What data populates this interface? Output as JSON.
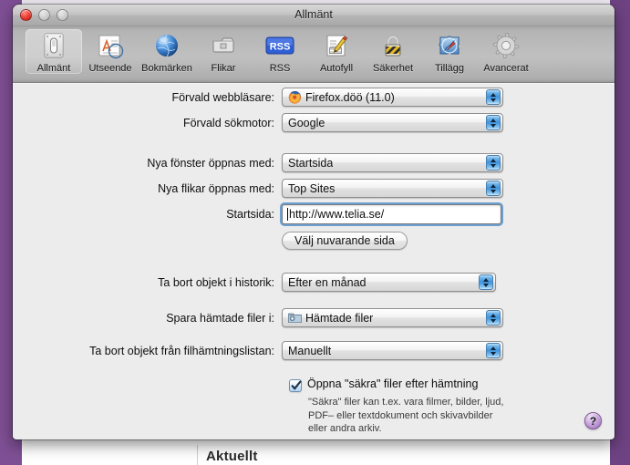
{
  "backdrop": {
    "heading": "Aktuellt",
    "purple": "#7e4f94"
  },
  "window": {
    "title": "Allmänt",
    "controls": {
      "close": "close-button",
      "minimize": "minimize-button",
      "zoom": "zoom-button"
    }
  },
  "toolbar": {
    "items": [
      {
        "label": "Allmänt",
        "icon": "general-switch-icon",
        "selected": true
      },
      {
        "label": "Utseende",
        "icon": "appearance-icon",
        "selected": false
      },
      {
        "label": "Bokmärken",
        "icon": "globe-bookmarks-icon",
        "selected": false
      },
      {
        "label": "Flikar",
        "icon": "tabs-icon",
        "selected": false
      },
      {
        "label": "RSS",
        "icon": "rss-icon",
        "selected": false
      },
      {
        "label": "Autofyll",
        "icon": "autofill-pencil-icon",
        "selected": false
      },
      {
        "label": "Säkerhet",
        "icon": "padlock-icon",
        "selected": false
      },
      {
        "label": "Tillägg",
        "icon": "extensions-puzzle-icon",
        "selected": false
      },
      {
        "label": "Avancerat",
        "icon": "gear-icon",
        "selected": false
      }
    ]
  },
  "form": {
    "default_browser": {
      "label": "Förvald webbläsare:",
      "value": "Firefox.döö (11.0)",
      "icon": "firefox-icon"
    },
    "default_search": {
      "label": "Förvald sökmotor:",
      "value": "Google"
    },
    "new_windows": {
      "label": "Nya fönster öppnas med:",
      "value": "Startsida"
    },
    "new_tabs": {
      "label": "Nya flikar öppnas med:",
      "value": "Top Sites"
    },
    "homepage": {
      "label": "Startsida:",
      "value": "http://www.telia.se/",
      "placeholder": "http://"
    },
    "set_current_page": {
      "label": "Välj nuvarande sida"
    },
    "remove_history": {
      "label": "Ta bort objekt i historik:",
      "value": "Efter en månad"
    },
    "download_location": {
      "label": "Spara hämtade filer i:",
      "value": "Hämtade filer",
      "icon": "downloads-folder-icon"
    },
    "remove_downloads": {
      "label": "Ta bort objekt från filhämtningslistan:",
      "value": "Manuellt"
    },
    "open_safe_files": {
      "label": "Öppna \"säkra\" filer efter hämtning",
      "checked": true,
      "help_line_1": "\"Säkra\" filer kan t.ex. vara filmer, bilder, ljud,",
      "help_line_2": "PDF– eller textdokument och skivavbilder",
      "help_line_3": "eller andra arkiv."
    },
    "help_button": {
      "label": "?"
    }
  },
  "colors": {
    "accent_blue": "#3d92dd",
    "focus_ring": "#5693ce",
    "window_bg": "#ececec",
    "help_purple": "#9a6fb6"
  }
}
